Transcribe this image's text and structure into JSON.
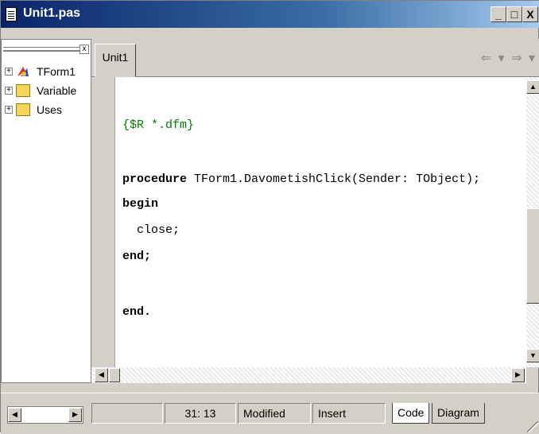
{
  "window": {
    "title": "Unit1.pas",
    "minimize_glyph": "_",
    "maximize_glyph": "□",
    "close_glyph": "X"
  },
  "explorer": {
    "close_glyph": "x",
    "items": [
      {
        "label": "TForm1",
        "expander": "+",
        "icon": "form-icon"
      },
      {
        "label": "Variable",
        "expander": "+",
        "icon": "folder-icon"
      },
      {
        "label": "Uses",
        "expander": "+",
        "icon": "folder-icon"
      }
    ]
  },
  "editor": {
    "tab_label": "Unit1",
    "nav_arrows": "⇐ ▾ ⇒ ▾",
    "lines": [
      {
        "text": "{$R *.dfm}",
        "style": "comment"
      },
      {
        "text": "procedure",
        "style": "kw",
        "rest": " TForm1.DavometishClick(Sender: TObject);"
      },
      {
        "text": "begin",
        "style": "kw"
      },
      {
        "text": "  close;",
        "style": "plain"
      },
      {
        "text": "end;",
        "style": "kw"
      },
      {
        "text": "end.",
        "style": "kw"
      }
    ]
  },
  "status": {
    "position": "31: 13",
    "modified": "Modified",
    "mode": "Insert",
    "tabs": [
      "Code",
      "Diagram"
    ]
  },
  "colors": {
    "comment": "#008000",
    "titlebar": "#0a246a",
    "chrome": "#d4d0c8"
  }
}
